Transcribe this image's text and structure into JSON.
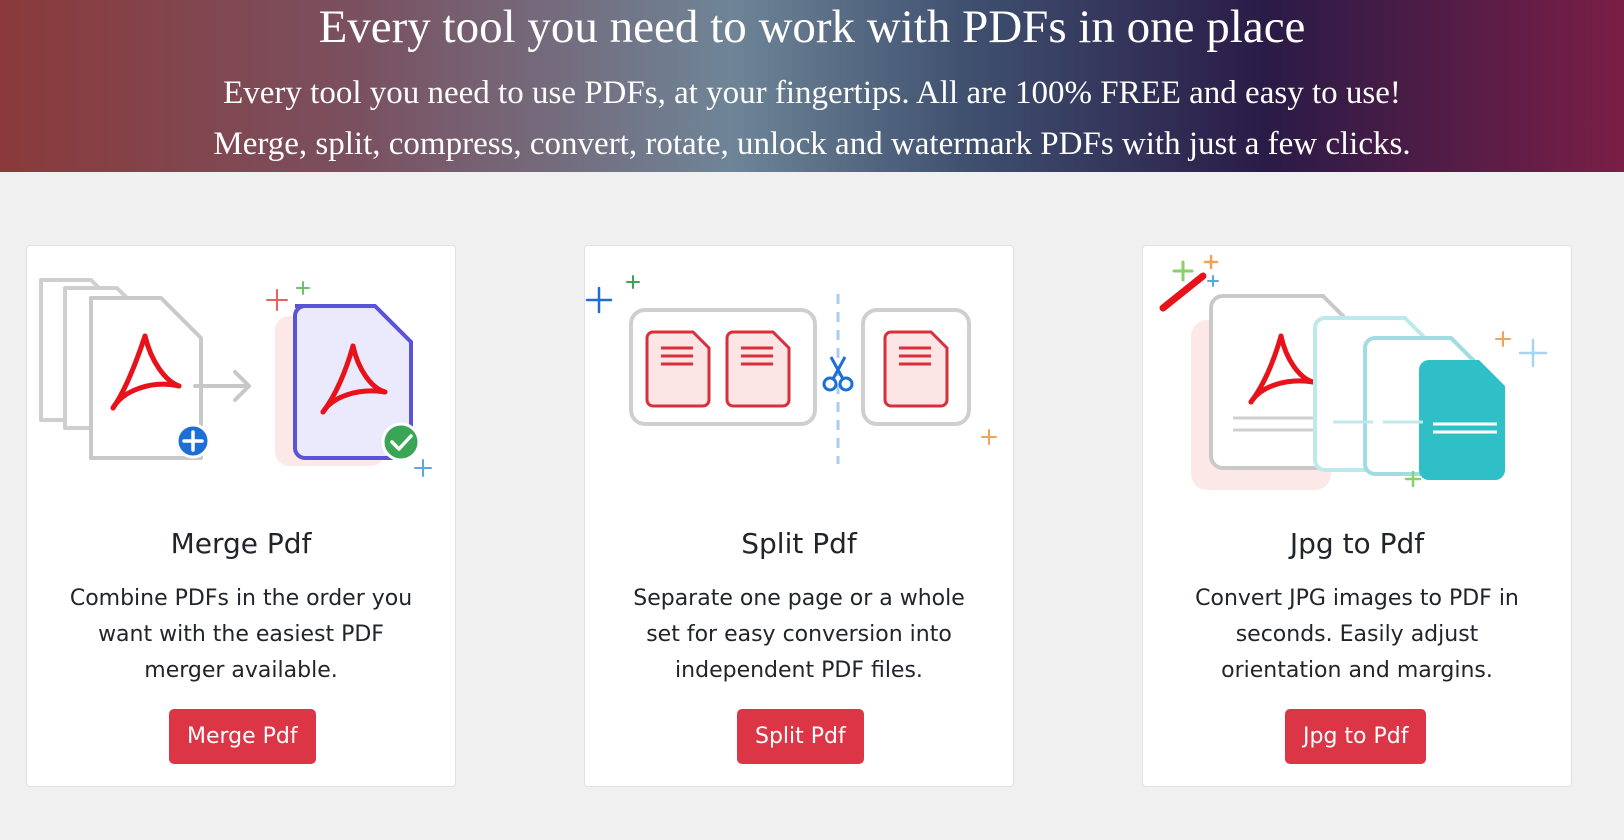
{
  "hero": {
    "title": "Every tool you need to work with PDFs in one place",
    "subtitle_line1": "Every tool you need to use PDFs, at your fingertips. All are 100% FREE and easy to use!",
    "subtitle_line2": "Merge, split, compress, convert, rotate, unlock and watermark PDFs with just a few clicks."
  },
  "tools": [
    {
      "title": "Merge Pdf",
      "description": "Combine PDFs in the order you want with the easiest PDF merger available.",
      "button_label": "Merge Pdf",
      "illustration": "merge-pdf-illustration"
    },
    {
      "title": "Split Pdf",
      "description": "Separate one page or a whole set for easy conversion into independent PDF files.",
      "button_label": "Split Pdf",
      "illustration": "split-pdf-illustration"
    },
    {
      "title": "Jpg to Pdf",
      "description": "Convert JPG images to PDF in seconds. Easily adjust orientation and margins.",
      "button_label": "Jpg to Pdf",
      "illustration": "jpg-to-pdf-illustration"
    }
  ],
  "colors": {
    "button": "#dc3545",
    "page_background": "#f0f0f0",
    "pdf_red": "#e8121a",
    "accent_blue": "#1c6fd6",
    "accent_green": "#3aa655",
    "accent_teal": "#2fbfc6"
  }
}
